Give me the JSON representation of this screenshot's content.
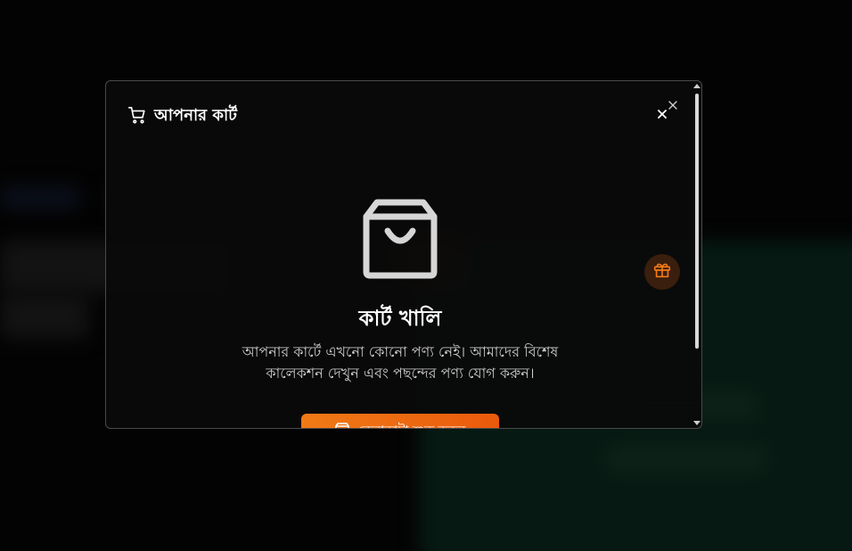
{
  "colors": {
    "accent": "#f07a16",
    "accent_dark": "#ea5a0c",
    "gift_bg": "#3a1e0e",
    "modal_border": "#4a4a4a",
    "text_primary": "#ffffff",
    "text_secondary": "#cfcfcf"
  },
  "cart": {
    "title": "আপনার কার্ট",
    "cart_icon": "shopping-cart-icon",
    "close_icon": "close-icon",
    "empty": {
      "icon": "shopping-bag-icon",
      "title": "কার্ট খালি",
      "message": "আপনার কার্টে এখনো কোনো পণ্য নেই। আমাদের বিশেষ কালেকশন দেখুন এবং পছন্দের পণ্য যোগ করুন।"
    },
    "shop_button": {
      "icon": "bag-icon",
      "label": "কেনাকাটা শুরু করুন"
    }
  },
  "floating": {
    "gift_icon": "gift-icon"
  }
}
